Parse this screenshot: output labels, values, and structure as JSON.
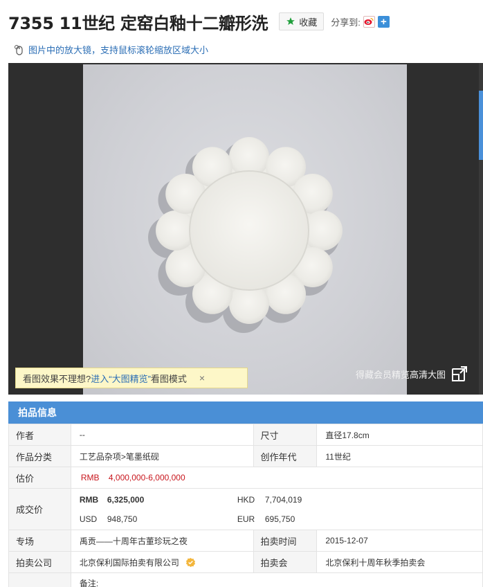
{
  "header": {
    "lot_title": "7355 11世纪 定窑白釉十二瓣形洗",
    "favorite_label": "收藏",
    "share_label": "分享到:"
  },
  "magnifier_tip": "图片中的放大镜，支持鼠标滚轮缩放区域大小",
  "viewer": {
    "hd_link_label": "得藏会员精览高清大图",
    "hint_text": "看图效果不理想?",
    "hint_link": "进入“大图精览”",
    "hint_mode": "看图模式",
    "hint_close": "×"
  },
  "info": {
    "section_title": "拍品信息",
    "author_label": "作者",
    "author_value": "--",
    "size_label": "尺寸",
    "size_value": "直径17.8cm",
    "category_label": "作品分类",
    "category_value": "工艺品杂项>笔墨纸砚",
    "era_label": "创作年代",
    "era_value": "11世纪",
    "estimate_label": "估价",
    "estimate_currency": "RMB",
    "estimate_value": "4,000,000-6,000,000",
    "deal_label": "成交价",
    "deal": {
      "rmb_cur": "RMB",
      "rmb_value": "6,325,000",
      "hkd_cur": "HKD",
      "hkd_value": "7,704,019",
      "usd_cur": "USD",
      "usd_value": "948,750",
      "eur_cur": "EUR",
      "eur_value": "695,750"
    },
    "session_label": "专场",
    "session_value": "禹贡——十周年古董珍玩之夜",
    "time_label": "拍卖时间",
    "time_value": "2015-12-07",
    "company_label": "拍卖公司",
    "company_value": "北京保利国际拍卖有限公司",
    "auction_label": "拍卖会",
    "auction_value": "北京保利十周年秋季拍卖会",
    "remark_label": "备注:"
  },
  "colors": {
    "accent_blue": "#4a8fd6",
    "price_red": "#c8161d",
    "link_blue": "#2b6eb5",
    "hint_bg": "#fdf7c8"
  }
}
